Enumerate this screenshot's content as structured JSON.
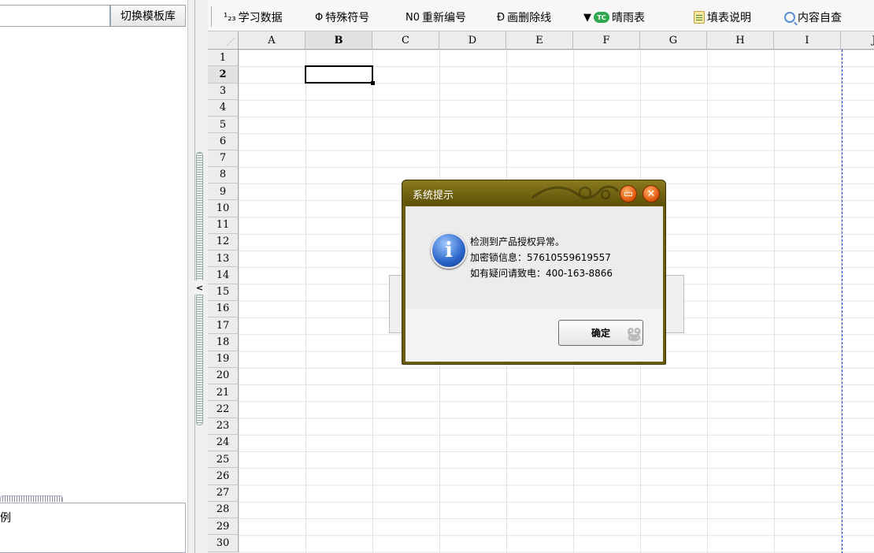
{
  "left_panel": {
    "template_search": {
      "value": "",
      "placeholder": ""
    },
    "switch_template_button": "切换模板库",
    "bottom_label": "例"
  },
  "toolbar": {
    "items": [
      {
        "icon": "superscript-numbers-icon",
        "icon_text": "¹₂₃",
        "label": "学习数据"
      },
      {
        "icon": "special-symbol-icon",
        "icon_text": "Φ",
        "label": "特殊符号"
      },
      {
        "icon": "renumber-icon",
        "icon_text": "N0",
        "label": "重新编号"
      },
      {
        "icon": "strikethrough-icon",
        "icon_text": "Ð",
        "label": "画删除线"
      },
      {
        "icon": "weather-cloud-icon",
        "icon_text": "TC",
        "label": "晴雨表",
        "dropdown": "▼"
      },
      {
        "icon": "document-edit-icon",
        "icon_text": "",
        "label": "填表说明"
      },
      {
        "icon": "magnifier-icon",
        "icon_text": "",
        "label": "内容自查"
      }
    ]
  },
  "sheet": {
    "columns": [
      "A",
      "B",
      "C",
      "D",
      "E",
      "F",
      "G",
      "H",
      "I",
      "J"
    ],
    "rows": [
      "1",
      "2",
      "3",
      "4",
      "5",
      "6",
      "7",
      "8",
      "9",
      "10",
      "11",
      "12",
      "13",
      "14",
      "15",
      "16",
      "17",
      "18",
      "19",
      "20",
      "21",
      "22",
      "23",
      "24",
      "25",
      "26",
      "27",
      "28",
      "29",
      "30"
    ],
    "active_cell": "B2"
  },
  "dialog": {
    "title": "系统提示",
    "message_lines": [
      "检测到产品授权异常。",
      "加密锁信息：57610559619557",
      "如有疑问请致电：400-163-8866"
    ],
    "ok_label": "确定",
    "minimize_glyph": "▭",
    "close_glyph": "✕",
    "theme_color": "#6b5e12"
  },
  "colors": {
    "page_break": "#1a3ad8",
    "dialog_button": "#e0570c",
    "info_icon": "#2a64c8"
  }
}
